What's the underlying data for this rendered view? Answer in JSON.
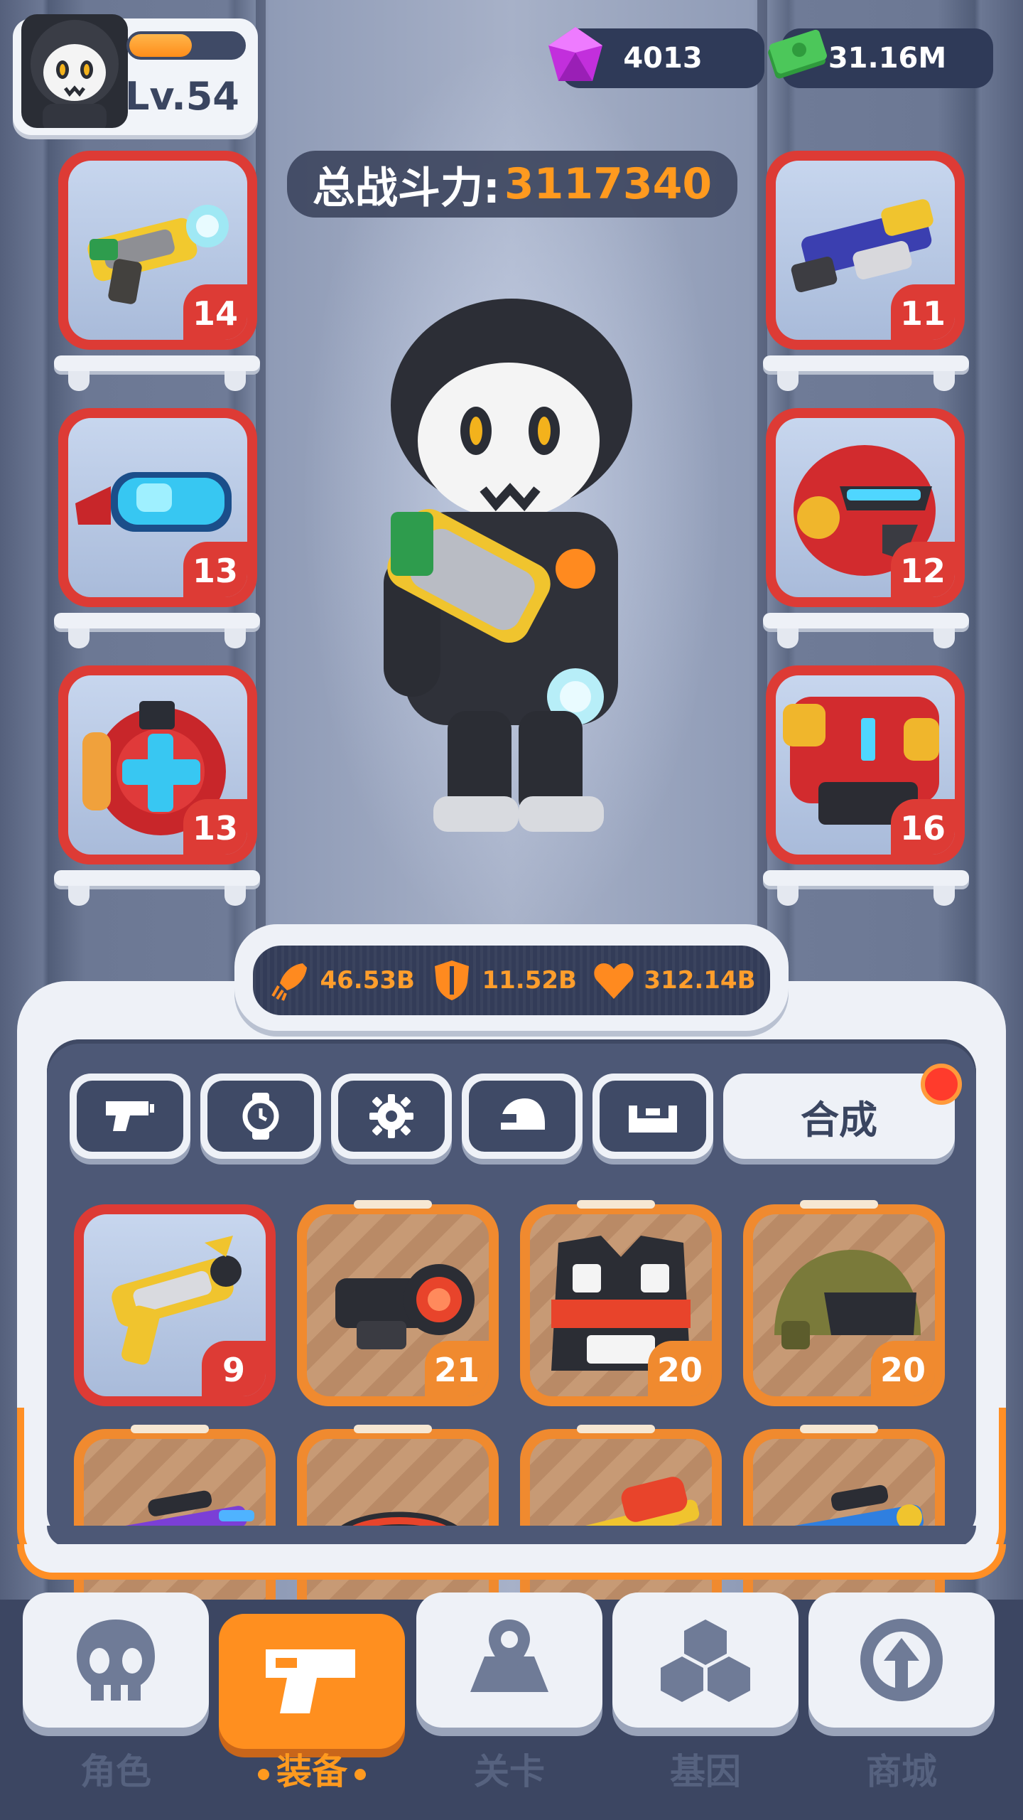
{
  "player": {
    "level": "Lv.54",
    "xp_progress": 0.55
  },
  "currencies": {
    "gems": "4013",
    "cash": "31.16M"
  },
  "power": {
    "label": "总战斗力:",
    "value": "3117340"
  },
  "equipped": {
    "left": [
      {
        "name": "blaster-gun",
        "level": "14"
      },
      {
        "name": "goggles",
        "level": "13"
      },
      {
        "name": "gauntlet",
        "level": "13"
      }
    ],
    "right": [
      {
        "name": "shotgun",
        "level": "11"
      },
      {
        "name": "helmet",
        "level": "12"
      },
      {
        "name": "armor",
        "level": "16"
      }
    ]
  },
  "stats": {
    "attack": "46.53B",
    "defense": "11.52B",
    "health": "312.14B"
  },
  "filter_tabs": [
    {
      "icon": "gun-icon"
    },
    {
      "icon": "watch-icon"
    },
    {
      "icon": "gear-icon"
    },
    {
      "icon": "helmet-icon"
    },
    {
      "icon": "armor-icon"
    }
  ],
  "merge_button": "合成",
  "inventory": [
    {
      "name": "golden-pistol",
      "level": "9",
      "rarity": "red"
    },
    {
      "name": "scope",
      "level": "21",
      "rarity": "orange"
    },
    {
      "name": "vest",
      "level": "20",
      "rarity": "orange"
    },
    {
      "name": "combat-helmet",
      "level": "20",
      "rarity": "orange"
    },
    {
      "name": "sniper-rifle",
      "level": "",
      "rarity": "orange"
    },
    {
      "name": "visor",
      "level": "",
      "rarity": "orange"
    },
    {
      "name": "rocket-launcher",
      "level": "",
      "rarity": "orange"
    },
    {
      "name": "blue-rifle",
      "level": "",
      "rarity": "orange"
    }
  ],
  "nav": [
    {
      "label": "角色",
      "icon": "skull-icon"
    },
    {
      "label": "装备",
      "icon": "gun-icon",
      "active": true
    },
    {
      "label": "关卡",
      "icon": "map-icon"
    },
    {
      "label": "基因",
      "icon": "gene-icon"
    },
    {
      "label": "商城",
      "icon": "shop-icon"
    }
  ],
  "colors": {
    "accent": "#ff8f1f",
    "rare_red": "#dd3b35",
    "epic_orange": "#f08a2f",
    "panel_dark": "#4d5876"
  }
}
